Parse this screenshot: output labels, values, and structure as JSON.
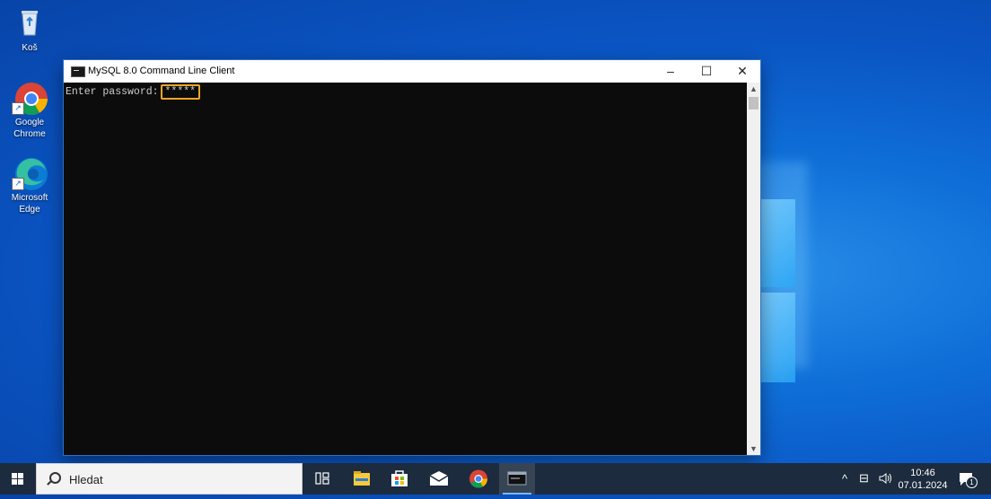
{
  "desktop": {
    "icons": [
      {
        "label": "Koš",
        "icon": "recycle-bin-icon"
      },
      {
        "label": "Google Chrome",
        "icon": "chrome-icon"
      },
      {
        "label": "Microsoft Edge",
        "icon": "edge-icon"
      }
    ]
  },
  "window": {
    "title": "MySQL 8.0 Command Line Client",
    "app_icon": "console-icon",
    "minimize": "–",
    "maximize": "☐",
    "close": "✕",
    "prompt": "Enter password:",
    "password_mask": "*****",
    "highlight_color": "#f5a623"
  },
  "taskbar": {
    "search_placeholder": "Hledat",
    "apps": [
      "task-view-icon",
      "file-explorer-icon",
      "store-icon",
      "mail-icon",
      "chrome-icon",
      "mysql-console-icon"
    ],
    "tray": {
      "chevron": "^",
      "network": "⊟",
      "volume": "🔈",
      "time": "10:46",
      "date": "07.01.2024",
      "notifications_count": "1"
    }
  }
}
